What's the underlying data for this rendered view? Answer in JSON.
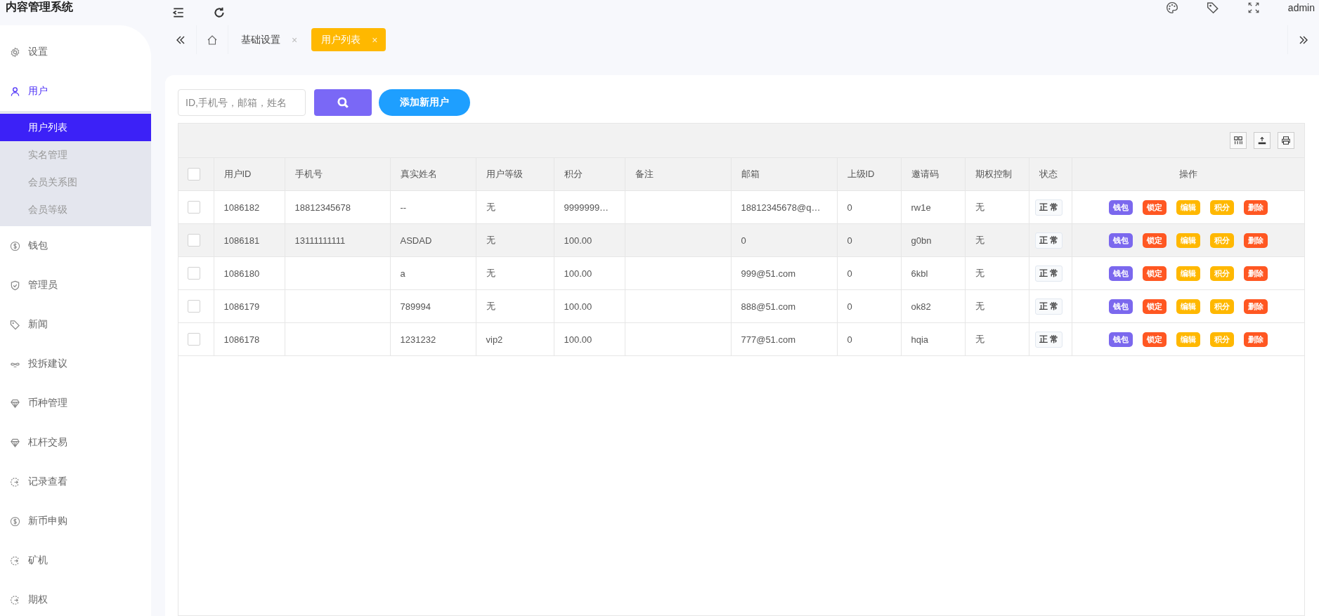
{
  "header": {
    "title": "内容管理系统",
    "user": "admin"
  },
  "sidebar": {
    "items": [
      {
        "label": "设置",
        "selected": false,
        "expanded": false
      },
      {
        "label": "用户",
        "selected": false,
        "expanded": true,
        "children": [
          {
            "label": "用户列表",
            "selected": true
          },
          {
            "label": "实名管理",
            "selected": false
          },
          {
            "label": "会员关系图",
            "selected": false
          },
          {
            "label": "会员等级",
            "selected": false
          }
        ]
      },
      {
        "label": "钱包",
        "selected": false,
        "expanded": false
      },
      {
        "label": "管理员",
        "selected": false,
        "expanded": false
      },
      {
        "label": "新闻",
        "selected": false,
        "expanded": false
      },
      {
        "label": "投拆建议",
        "selected": false,
        "expanded": false
      },
      {
        "label": "币种管理",
        "selected": false,
        "expanded": false
      },
      {
        "label": "杠杆交易",
        "selected": false,
        "expanded": false
      },
      {
        "label": "记录查看",
        "selected": false,
        "expanded": false
      },
      {
        "label": "新币申购",
        "selected": false,
        "expanded": false
      },
      {
        "label": "矿机",
        "selected": false,
        "expanded": false
      },
      {
        "label": "期权",
        "selected": false,
        "expanded": false
      }
    ]
  },
  "tabs": [
    {
      "kind": "home",
      "selected": false
    },
    {
      "kind": "page",
      "label": "基础设置",
      "close": "×",
      "selected": false
    },
    {
      "kind": "page",
      "label": "用户列表",
      "close": "×",
      "selected": true
    }
  ],
  "search": {
    "placeholder": "ID,手机号，邮箱，姓名"
  },
  "add_button": "添加新用户",
  "table": {
    "select_all": {
      "checked": false
    },
    "columns": [
      "用户ID",
      "手机号",
      "真实姓名",
      "用户等级",
      "积分",
      "备注",
      "邮箱",
      "上级ID",
      "邀请码",
      "期权控制",
      "状态",
      "操作"
    ],
    "rows": [
      {
        "checked": false,
        "selected": false,
        "cells": [
          "1086182",
          "18812345678",
          "--",
          "无",
          "9999999…",
          "",
          "18812345678@q…",
          "0",
          "rw1e",
          "无"
        ],
        "status": "正 常",
        "actions": [
          {
            "label": "钱包",
            "color": "#7b68ee"
          },
          {
            "label": "锁定",
            "color": "#ff5722"
          },
          {
            "label": "编辑",
            "color": "#ffb800"
          },
          {
            "label": "积分",
            "color": "#ffb800"
          },
          {
            "label": "删除",
            "color": "#ff5722"
          }
        ]
      },
      {
        "checked": false,
        "selected": true,
        "cells": [
          "1086181",
          "13111111111",
          "ASDAD",
          "无",
          "100.00",
          "",
          "0",
          "0",
          "g0bn",
          "无"
        ],
        "status": "正 常",
        "actions": [
          {
            "label": "钱包",
            "color": "#7b68ee"
          },
          {
            "label": "锁定",
            "color": "#ff5722"
          },
          {
            "label": "编辑",
            "color": "#ffb800"
          },
          {
            "label": "积分",
            "color": "#ffb800"
          },
          {
            "label": "删除",
            "color": "#ff5722"
          }
        ]
      },
      {
        "checked": false,
        "selected": false,
        "cells": [
          "1086180",
          "",
          "a",
          "无",
          "100.00",
          "",
          "999@51.com",
          "0",
          "6kbl",
          "无"
        ],
        "status": "正 常",
        "actions": [
          {
            "label": "钱包",
            "color": "#7b68ee"
          },
          {
            "label": "锁定",
            "color": "#ff5722"
          },
          {
            "label": "编辑",
            "color": "#ffb800"
          },
          {
            "label": "积分",
            "color": "#ffb800"
          },
          {
            "label": "删除",
            "color": "#ff5722"
          }
        ]
      },
      {
        "checked": false,
        "selected": false,
        "cells": [
          "1086179",
          "",
          "789994",
          "无",
          "100.00",
          "",
          "888@51.com",
          "0",
          "ok82",
          "无"
        ],
        "status": "正 常",
        "actions": [
          {
            "label": "钱包",
            "color": "#7b68ee"
          },
          {
            "label": "锁定",
            "color": "#ff5722"
          },
          {
            "label": "编辑",
            "color": "#ffb800"
          },
          {
            "label": "积分",
            "color": "#ffb800"
          },
          {
            "label": "删除",
            "color": "#ff5722"
          }
        ]
      },
      {
        "checked": false,
        "selected": false,
        "cells": [
          "1086178",
          "",
          "1231232",
          "vip2",
          "100.00",
          "",
          "777@51.com",
          "0",
          "hqia",
          "无"
        ],
        "status": "正 常",
        "actions": [
          {
            "label": "钱包",
            "color": "#7b68ee"
          },
          {
            "label": "锁定",
            "color": "#ff5722"
          },
          {
            "label": "编辑",
            "color": "#ffb800"
          },
          {
            "label": "积分",
            "color": "#ffb800"
          },
          {
            "label": "删除",
            "color": "#ff5722"
          }
        ]
      }
    ]
  }
}
